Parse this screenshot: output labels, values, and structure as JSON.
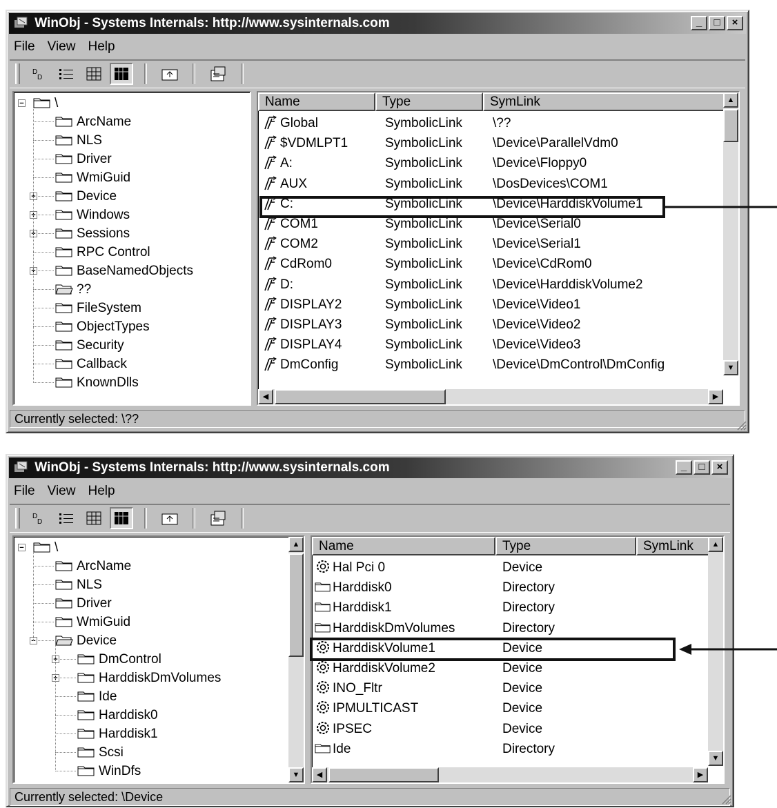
{
  "title": "WinObj - Systems Internals: http://www.sysinternals.com",
  "menu": {
    "file": "File",
    "view": "View",
    "help": "Help"
  },
  "window1": {
    "tree": [
      {
        "label": "\\",
        "level": 0,
        "toggle": "-"
      },
      {
        "label": "ArcName",
        "level": 1,
        "toggle": ""
      },
      {
        "label": "NLS",
        "level": 1,
        "toggle": ""
      },
      {
        "label": "Driver",
        "level": 1,
        "toggle": ""
      },
      {
        "label": "WmiGuid",
        "level": 1,
        "toggle": ""
      },
      {
        "label": "Device",
        "level": 1,
        "toggle": "+"
      },
      {
        "label": "Windows",
        "level": 1,
        "toggle": "+"
      },
      {
        "label": "Sessions",
        "level": 1,
        "toggle": "+"
      },
      {
        "label": "RPC Control",
        "level": 1,
        "toggle": ""
      },
      {
        "label": "BaseNamedObjects",
        "level": 1,
        "toggle": "+"
      },
      {
        "label": "??",
        "level": 1,
        "toggle": "",
        "open": true
      },
      {
        "label": "FileSystem",
        "level": 1,
        "toggle": ""
      },
      {
        "label": "ObjectTypes",
        "level": 1,
        "toggle": ""
      },
      {
        "label": "Security",
        "level": 1,
        "toggle": ""
      },
      {
        "label": "Callback",
        "level": 1,
        "toggle": ""
      },
      {
        "label": "KnownDlls",
        "level": 1,
        "toggle": ""
      }
    ],
    "columns": [
      "Name",
      "Type",
      "SymLink"
    ],
    "rows": [
      {
        "name": "Global",
        "type": "SymbolicLink",
        "symlink": "\\??"
      },
      {
        "name": "$VDMLPT1",
        "type": "SymbolicLink",
        "symlink": "\\Device\\ParallelVdm0"
      },
      {
        "name": "A:",
        "type": "SymbolicLink",
        "symlink": "\\Device\\Floppy0"
      },
      {
        "name": "AUX",
        "type": "SymbolicLink",
        "symlink": "\\DosDevices\\COM1"
      },
      {
        "name": "C:",
        "type": "SymbolicLink",
        "symlink": "\\Device\\HarddiskVolume1",
        "highlight": true
      },
      {
        "name": "COM1",
        "type": "SymbolicLink",
        "symlink": "\\Device\\Serial0"
      },
      {
        "name": "COM2",
        "type": "SymbolicLink",
        "symlink": "\\Device\\Serial1"
      },
      {
        "name": "CdRom0",
        "type": "SymbolicLink",
        "symlink": "\\Device\\CdRom0"
      },
      {
        "name": "D:",
        "type": "SymbolicLink",
        "symlink": "\\Device\\HarddiskVolume2"
      },
      {
        "name": "DISPLAY2",
        "type": "SymbolicLink",
        "symlink": "\\Device\\Video1"
      },
      {
        "name": "DISPLAY3",
        "type": "SymbolicLink",
        "symlink": "\\Device\\Video2"
      },
      {
        "name": "DISPLAY4",
        "type": "SymbolicLink",
        "symlink": "\\Device\\Video3"
      },
      {
        "name": "DmConfig",
        "type": "SymbolicLink",
        "symlink": "\\Device\\DmControl\\DmConfig"
      }
    ],
    "status": "Currently selected:  \\??"
  },
  "window2": {
    "tree": [
      {
        "label": "\\",
        "level": 0,
        "toggle": "-"
      },
      {
        "label": "ArcName",
        "level": 1,
        "toggle": ""
      },
      {
        "label": "NLS",
        "level": 1,
        "toggle": ""
      },
      {
        "label": "Driver",
        "level": 1,
        "toggle": ""
      },
      {
        "label": "WmiGuid",
        "level": 1,
        "toggle": ""
      },
      {
        "label": "Device",
        "level": 1,
        "toggle": "-",
        "open": true
      },
      {
        "label": "DmControl",
        "level": 2,
        "toggle": "+"
      },
      {
        "label": "HarddiskDmVolumes",
        "level": 2,
        "toggle": "+"
      },
      {
        "label": "Ide",
        "level": 2,
        "toggle": ""
      },
      {
        "label": "Harddisk0",
        "level": 2,
        "toggle": ""
      },
      {
        "label": "Harddisk1",
        "level": 2,
        "toggle": ""
      },
      {
        "label": "Scsi",
        "level": 2,
        "toggle": ""
      },
      {
        "label": "WinDfs",
        "level": 2,
        "toggle": ""
      }
    ],
    "columns": [
      "Name",
      "Type",
      "SymLink"
    ],
    "rows": [
      {
        "name": "Hal Pci 0",
        "type": "Device",
        "icon": "device"
      },
      {
        "name": "Harddisk0",
        "type": "Directory",
        "icon": "folder"
      },
      {
        "name": "Harddisk1",
        "type": "Directory",
        "icon": "folder"
      },
      {
        "name": "HarddiskDmVolumes",
        "type": "Directory",
        "icon": "folder"
      },
      {
        "name": "HarddiskVolume1",
        "type": "Device",
        "icon": "device",
        "highlight": true
      },
      {
        "name": "HarddiskVolume2",
        "type": "Device",
        "icon": "device"
      },
      {
        "name": "INO_Fltr",
        "type": "Device",
        "icon": "device"
      },
      {
        "name": "IPMULTICAST",
        "type": "Device",
        "icon": "device"
      },
      {
        "name": "IPSEC",
        "type": "Device",
        "icon": "device"
      },
      {
        "name": "Ide",
        "type": "Directory",
        "icon": "folder"
      }
    ],
    "status": "Currently selected:  \\Device"
  }
}
